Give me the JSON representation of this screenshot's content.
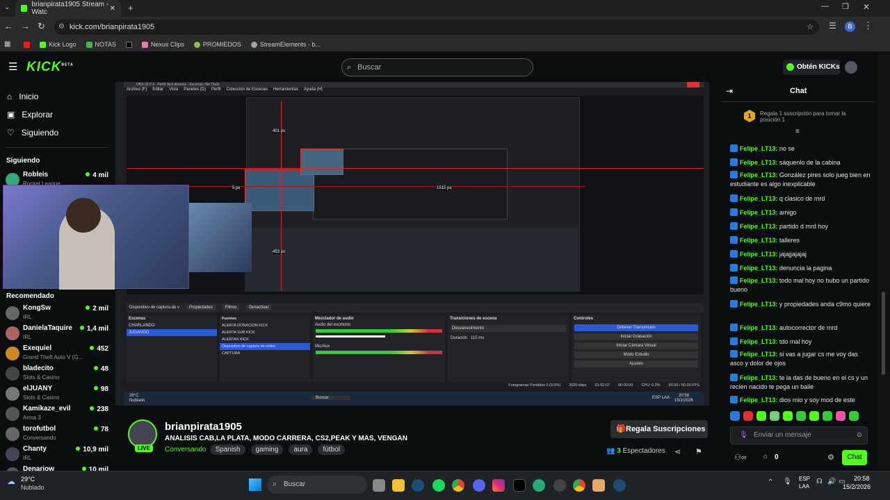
{
  "browser": {
    "tab_title": "brianpirata1905 Stream - Watc",
    "url": "kick.com/brianpirata1905",
    "bookmarks": [
      "Kick Logo",
      "NOTAS",
      "Nexus Clips",
      "PROMIEDOS",
      "StreamElements - b..."
    ],
    "profile_initial": "B"
  },
  "header": {
    "logo": "KICK",
    "logo_sup": "BETA",
    "search_placeholder": "Buscar",
    "kicks_button": "Obtén KICKs"
  },
  "sidebar": {
    "nav": [
      "Inicio",
      "Explorar",
      "Siguiendo"
    ],
    "following_title": "Siguiendo",
    "following": [
      {
        "name": "Robleis",
        "category": "Rocket League",
        "viewers": "4 mil"
      }
    ],
    "recommended_title": "Recomendado",
    "recommended": [
      {
        "name": "KongSw",
        "category": "IRL",
        "viewers": "2 mil"
      },
      {
        "name": "DanielaTaquire",
        "category": "IRL",
        "viewers": "1,4 mil"
      },
      {
        "name": "Exequiel",
        "category": "Grand Theft Auto V (G...",
        "viewers": "452"
      },
      {
        "name": "bladecito",
        "category": "Slots & Casino",
        "viewers": "48"
      },
      {
        "name": "elJUANY",
        "category": "Slots & Casino",
        "viewers": "98"
      },
      {
        "name": "Kamikaze_evil",
        "category": "Arma 3",
        "viewers": "238"
      },
      {
        "name": "torofutbol",
        "category": "Conversando",
        "viewers": "78"
      },
      {
        "name": "Chanty",
        "category": "IRL",
        "viewers": "10,9 mil"
      },
      {
        "name": "Denariow",
        "category": "",
        "viewers": "10 mil"
      }
    ]
  },
  "video": {
    "obs_title": "OBS 32.0.4 - Perfil: kick directos - Escenas: Sin Título",
    "obs_menu": [
      "Archivo (F)",
      "Editar",
      "Vista",
      "Paneles (D)",
      "Perfil",
      "Colección de Escenas",
      "Herramientas",
      "Ayuda (H)"
    ],
    "dims": [
      "401 px",
      "5 px",
      "1515 px",
      "453 px"
    ],
    "source_label": "Dispositivo de captura de v",
    "props_btn": "Propiedades",
    "filters_btn": "Filtros",
    "deactivate_btn": "Desactivar",
    "panels": {
      "scenes_title": "Escenas",
      "scenes": [
        "CHARLANDO",
        "JUGANDO"
      ],
      "sources_title": "Fuentes",
      "sources": [
        "ALERTA DONACION KICK",
        "ALERTA SUB KICK",
        "ALERTAS KICK",
        "Dispositivo de captura de vídeo",
        "CAPTURA"
      ],
      "mixer_title": "Mezclador de audio",
      "mixer_tracks": [
        {
          "name": "Audio del escritorio",
          "db": "-15.5 dB"
        },
        {
          "name": "Mic/Aux",
          "db": "-3.4 dB"
        }
      ],
      "transitions_title": "Transiciones de escena",
      "transition_value": "Desvanecimiento",
      "duration_label": "Duración",
      "duration_value": "115 ms",
      "controls_title": "Controles",
      "controls": [
        "Detener Transmisión",
        "Iniciar Grabación",
        "Iniciar Cámara Virtual",
        "Modo Estudio",
        "Ajustes"
      ]
    },
    "status": {
      "dropped": "Fotogramas Perdidos 0 (0.0%)",
      "bitrate": "2020 kbps",
      "time1": "01:52:07",
      "time2": "00:00:00",
      "cpu": "CPU: 6.0%",
      "fps": "60.00 / 60.00 FPS"
    },
    "inner_taskbar": {
      "temp": "29°C",
      "weather": "Nublado",
      "search": "Buscar",
      "lang": "ESP LAA",
      "time": "20:58",
      "date": "15/2/2026"
    }
  },
  "stream": {
    "channel": "brianpirata1905",
    "title": "ANALISIS CAB,LA PLATA, MODO CARRERA, CS2,PEAK Y MAS, VENGAN",
    "category": "Conversando",
    "tags": [
      "Spanish",
      "gaming",
      "aura",
      "fútbol"
    ],
    "live_badge": "LIVE",
    "gift_button": "Regala Suscripciones",
    "viewers_count": "3",
    "viewers_label": "Espectadores"
  },
  "chat": {
    "title": "Chat",
    "gift_prompt": "Regala 1 suscripción para tomar la posición 1",
    "gift_rank": "1",
    "messages": [
      {
        "user": "Felipe_LT13:",
        "text": "no se"
      },
      {
        "user": "Felipe_LT13:",
        "text": "sáquenlo de la cabina"
      },
      {
        "user": "Felipe_LT13:",
        "text": "González pires solo jueg bien en estudiante es algo inexplicable"
      },
      {
        "user": "Felipe_LT13:",
        "text": "q clasico de mrd"
      },
      {
        "user": "Felipe_LT13:",
        "text": "amigo"
      },
      {
        "user": "Felipe_LT13:",
        "text": "partido d mrd hoy"
      },
      {
        "user": "Felipe_LT13:",
        "text": "talleres"
      },
      {
        "user": "Felipe_LT13:",
        "text": "jajajjajajaj"
      },
      {
        "user": "Felipe_LT13:",
        "text": "denuncia la pagina"
      },
      {
        "user": "Felipe_LT13:",
        "text": "todo mal hoy no hubo un partido bueno"
      },
      {
        "user": "Felipe_LT13:",
        "text": "y propiedades anda c9mo quiere"
      },
      {
        "user": "Felipe_LT13:",
        "text": "autocorrector de mrd"
      },
      {
        "user": "Felipe_LT13:",
        "text": "tdo mal hoy"
      },
      {
        "user": "Felipe_LT13:",
        "text": "si vas a jugar cs me voy das asco y dolor de ojos"
      },
      {
        "user": "Felipe_LT13:",
        "text": "te la das de bueno en el cs y un recien nacido te pega un baile"
      },
      {
        "user": "Felipe_LT13:",
        "text": "dios mio y soy mod de este"
      }
    ],
    "input_placeholder": "Enviar un mensaje",
    "points": "0",
    "send_button": "Chat"
  },
  "taskbar": {
    "temp": "29°C",
    "weather": "Nublado",
    "search": "Buscar",
    "lang": "ESP",
    "lang2": "LAA",
    "time": "20:58",
    "date": "15/2/2026"
  }
}
